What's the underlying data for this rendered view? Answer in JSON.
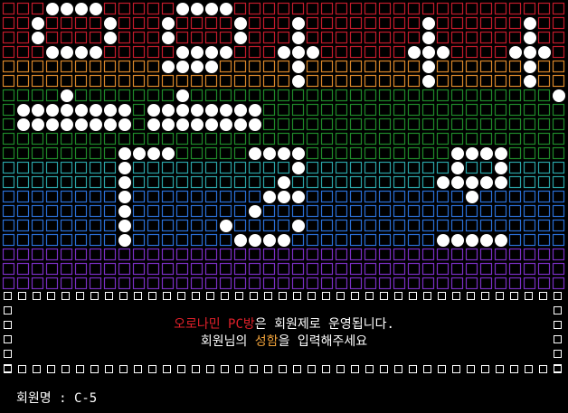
{
  "banner": {
    "row_colors": [
      "#c21b2b",
      "#c21b2b",
      "#c21b2b",
      "#c21b2b",
      "#d9862a",
      "#d9862a",
      "#1f8a2a",
      "#1f8a2a",
      "#1f8a2a",
      "#1f8a2a",
      "#1f8a2a",
      "#2aa3a6",
      "#2aa3a6",
      "#2a6fd6",
      "#2a6fd6",
      "#2a6fd6",
      "#2a6fd6",
      "#7a2fc4",
      "#7a2fc4",
      "#7a2fc4"
    ],
    "dot_color": "#ffffff",
    "pattern": [
      "...####.....####..............................",
      "..#....#...#....#...#........#......#.....#...",
      "..#....#...#....#...#........#......#.....#...",
      "...####.....####...###......###....###...###..",
      "...........####.....#........#......#.....#...",
      "....................#........#......#.....#...",
      "....#.......#.........................#.......",
      ".########.########.......................########.",
      ".########.########.......................########.",
      "..................................................",
      "........####.....####..........####......#......",
      "........#...........#..........#..#......#......",
      "........#..........#..........#####......##.....",
      "........#.........###...........#........#......",
      "........#........#...........................#...",
      "........#......#....#.........................#..",
      "........#.......####..........#####.....####.....",
      "...................................................",
      "...................................................",
      "..................................................."
    ]
  },
  "message": {
    "line1_red": "오로나민 PC방",
    "line1_rest": "은 회원제로 운영됩니다.",
    "line2_pre": "회원님의 ",
    "line2_orange": "성함",
    "line2_post": "을 입력해주세요"
  },
  "prompt": {
    "label": "회원명",
    "separator": " : ",
    "value": "C-5"
  }
}
